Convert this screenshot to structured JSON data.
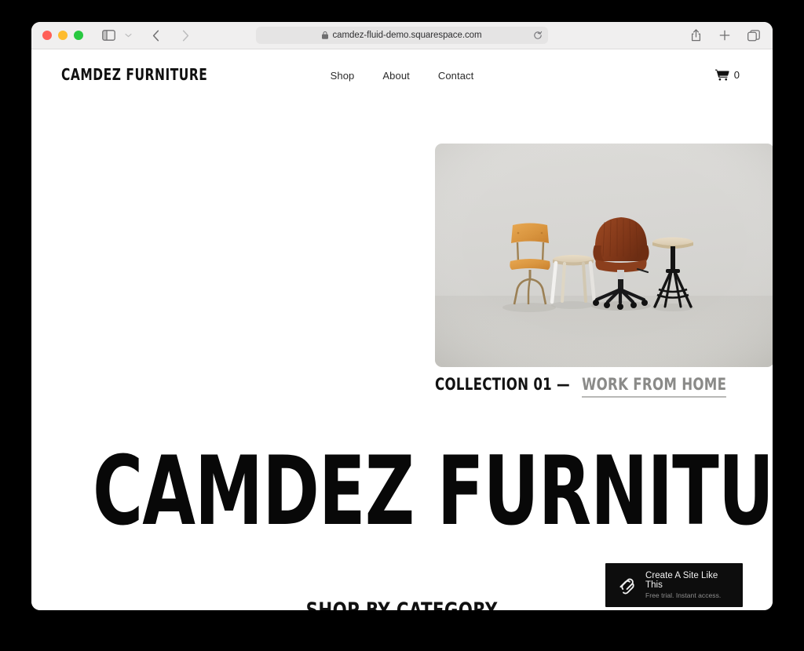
{
  "browser": {
    "url": "camdez-fluid-demo.squarespace.com",
    "traffic_lights": [
      "close",
      "minimize",
      "maximize"
    ],
    "controls": {
      "sidebar": "sidebar-icon",
      "tab_overview_chevron": "chevron-down-icon",
      "back": "back-arrow-icon",
      "forward": "forward-arrow-icon",
      "lock": "lock-icon",
      "reload": "reload-icon",
      "share": "share-icon",
      "new_tab": "plus-icon",
      "tabs": "tabs-icon"
    }
  },
  "site": {
    "brand": "CAMDEZ FURNITURE",
    "nav": [
      {
        "label": "Shop"
      },
      {
        "label": "About"
      },
      {
        "label": "Contact"
      }
    ],
    "cart": {
      "icon": "shopping-cart-icon",
      "count": "0"
    },
    "hero": {
      "image_alt": "Four chairs and stools arranged on a light grey studio background",
      "collection_label": "COLLECTION 01 —",
      "collection_link": "WORK FROM HOME"
    },
    "headline": "CAMDEZ FURNITURE",
    "section_title": "SHOP BY CATEGORY"
  },
  "badge": {
    "logo": "squarespace-logo-icon",
    "title": "Create A Site Like This",
    "subtitle": "Free trial. Instant access."
  },
  "colors": {
    "page_background": "#ffffff",
    "desktop_background": "#000000",
    "toolbar": "#f0efef",
    "text": "#101010",
    "muted_text": "#8a8a88",
    "badge_background": "#0d0d0d",
    "hero_background": "#d6d5d2",
    "leather": "#8b4020",
    "plywood": "#d99a42"
  }
}
